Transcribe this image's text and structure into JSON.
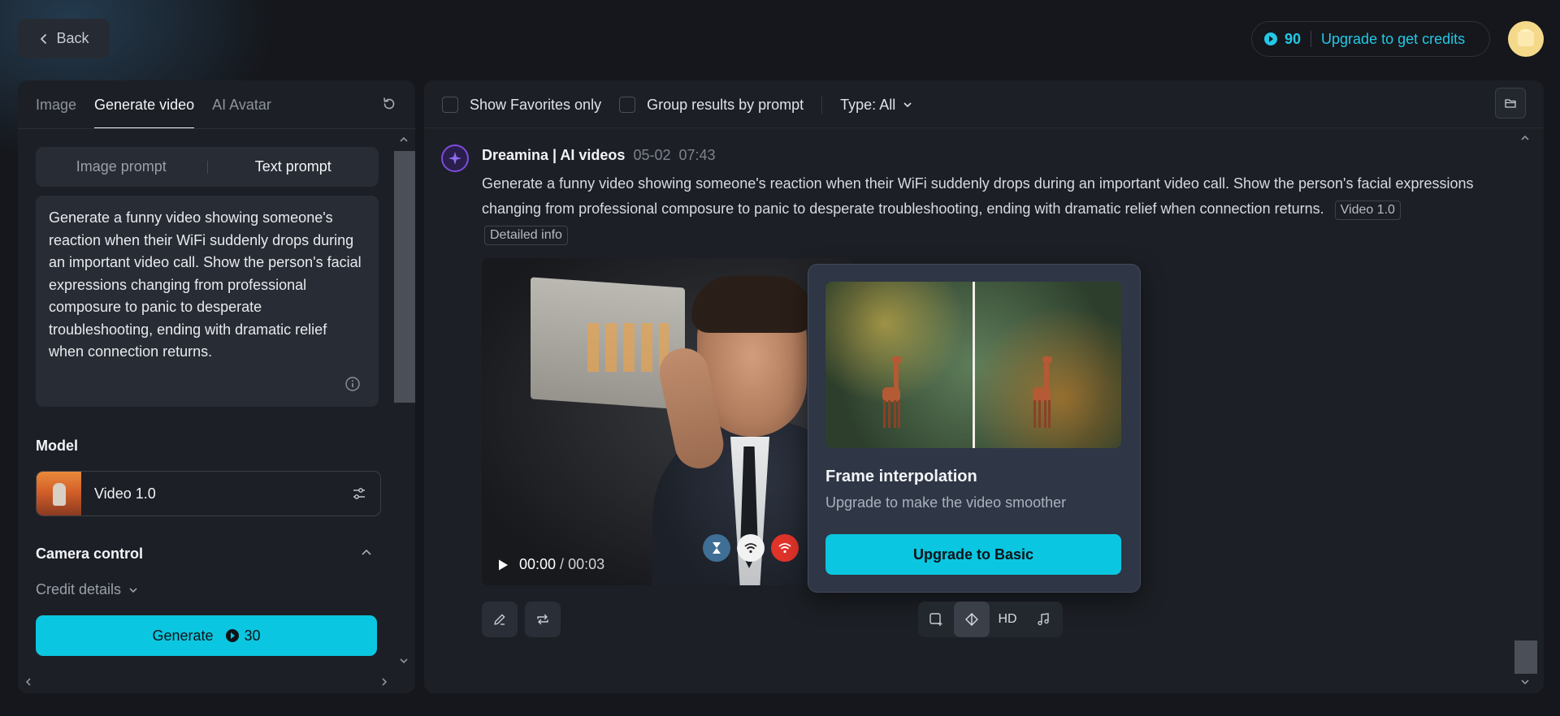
{
  "header": {
    "back_label": "Back",
    "credits": "90",
    "upgrade_label": "Upgrade to get credits"
  },
  "left": {
    "tabs": [
      {
        "label": "Image",
        "active": false
      },
      {
        "label": "Generate video",
        "active": true
      },
      {
        "label": "AI Avatar",
        "active": false
      }
    ],
    "prompt_modes": [
      "Image prompt",
      "Text prompt"
    ],
    "active_mode": "Text prompt",
    "prompt_text": "Generate a funny video showing someone's reaction when their WiFi suddenly drops during an important video call. Show the person's facial expressions changing from professional composure to panic to desperate troubleshooting, ending with dramatic relief when connection returns.",
    "model_label": "Model",
    "model_name": "Video 1.0",
    "camera_label": "Camera control",
    "credit_details_label": "Credit details",
    "generate_label": "Generate",
    "generate_cost": "30"
  },
  "right": {
    "filters": {
      "favorites_label": "Show Favorites only",
      "group_label": "Group results by prompt",
      "type_label": "Type: All"
    },
    "message": {
      "author": "Dreamina | AI videos",
      "date": "05-02",
      "time": "07:43",
      "text": "Generate a funny video showing someone's reaction when their WiFi suddenly drops during an important video call. Show the person's facial expressions changing from professional composure to panic to desperate troubleshooting, ending with dramatic relief when connection returns.",
      "model_tag": "Video 1.0",
      "detail_tag": "Detailed info"
    },
    "video": {
      "current_time": "00:00",
      "separator": " / ",
      "total_time": "00:03"
    },
    "popup": {
      "title": "Frame interpolation",
      "subtitle": "Upgrade to make the video smoother",
      "button_label": "Upgrade to Basic"
    },
    "toolbar": {
      "hd_label": "HD"
    }
  },
  "colors": {
    "accent": "#0bc6e0",
    "background": "#15171c",
    "panel": "#1c1f25"
  }
}
